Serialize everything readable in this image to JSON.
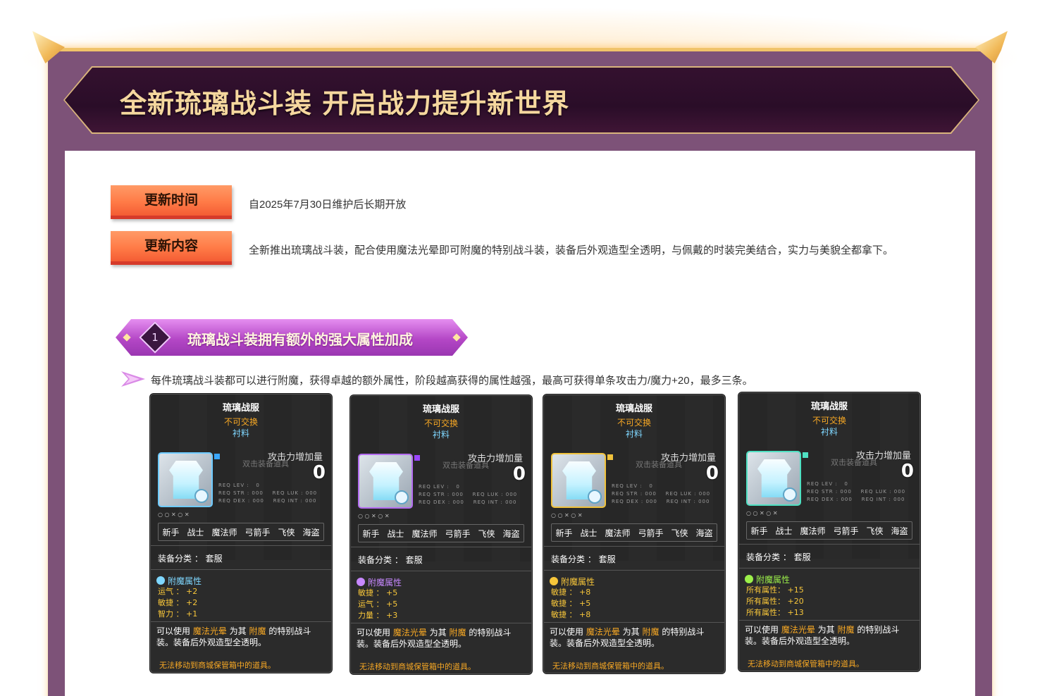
{
  "banner": {
    "title": "全新琉璃战斗装  开启战力提升新世界"
  },
  "info": {
    "time_label": "更新时间",
    "time_text": "自2025年7月30日维护后长期开放",
    "content_label": "更新内容",
    "content_text": "全新推出琉璃战斗装，配合使用魔法光晕即可附魔的特别战斗装，装备后外观造型全透明，与佩戴的时装完美结合，实力与美貌全都拿下。"
  },
  "section1": {
    "number": "1",
    "title": "琉璃战斗装拥有额外的强大属性加成",
    "desc": "每件琉璃战斗装都可以进行附魔，获得卓越的额外属性，阶段越高获得的属性越强，最高可获得单条攻击力/魔力+20，最多三条。"
  },
  "card_common": {
    "name": "琉璃战服",
    "trade": "不可交换",
    "material": "衬料",
    "atk_label": "攻击力增加量",
    "atk_value": "0",
    "ghost": "双击装备道具",
    "req": "REQ LEV :   0\nREQ STR : 000    REQ LUK : 000\nREQ DEX : 000    REQ INT : 000",
    "small_row": "○          ○ ✕          ○ ✕",
    "jobs": [
      "新手",
      "战士",
      "魔法师",
      "弓箭手",
      "飞侠",
      "海盗"
    ],
    "category": "装备分类 ： 套服",
    "desc_1": "可以使用 ",
    "desc_hl1": "魔法光晕",
    "desc_2": " 为其 ",
    "desc_hl2": "附魔",
    "desc_3": " 的特别战斗装。装备后外观造型全透明。",
    "warn": "无法移动到商城保管箱中的道具。"
  },
  "cards": [
    {
      "bonus_title": "附魔属性",
      "tier": "blue",
      "stats": [
        "运气 ： +2",
        "敏捷 ： +2",
        "智力 ： +1"
      ]
    },
    {
      "bonus_title": "附魔属性",
      "tier": "purple",
      "stats": [
        "敏捷 ： +5",
        "运气 ： +5",
        "力量 ： +3"
      ]
    },
    {
      "bonus_title": "附魔属性",
      "tier": "gold",
      "stats": [
        "敏捷 ： +8",
        "敏捷 ： +5",
        "敏捷 ： +8"
      ]
    },
    {
      "bonus_title": "附魔属性",
      "tier": "green",
      "stats": [
        "所有属性： +15",
        "所有属性： +20",
        "所有属性： +13"
      ]
    }
  ],
  "colors": {
    "frame": "#7d5278",
    "banner_bg": "#2a0d28",
    "tag": "#ff7b47",
    "section": "#b447c6",
    "card_bg": "#2b2b2b"
  }
}
